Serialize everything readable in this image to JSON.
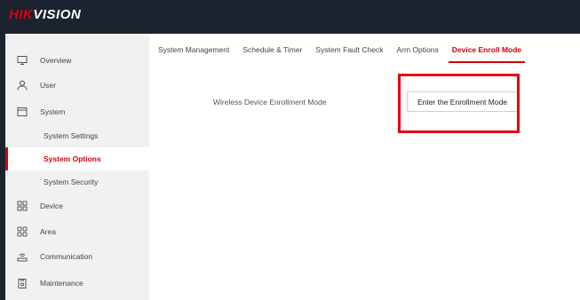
{
  "brand": {
    "logo_part1": "HIK",
    "logo_part2": "VISION",
    "accent_color": "#d7000f"
  },
  "sidebar": {
    "items": [
      {
        "label": "Overview",
        "icon": "monitor-icon"
      },
      {
        "label": "User",
        "icon": "user-icon"
      },
      {
        "label": "System",
        "icon": "window-icon"
      },
      {
        "label": "Device",
        "icon": "grid-icon"
      },
      {
        "label": "Area",
        "icon": "area-icon"
      },
      {
        "label": "Communication",
        "icon": "network-icon"
      },
      {
        "label": "Maintenance",
        "icon": "clipboard-icon"
      }
    ],
    "system_subitems": [
      {
        "label": "System Settings",
        "active": false
      },
      {
        "label": "System Options",
        "active": true
      },
      {
        "label": "System Security",
        "active": false
      }
    ]
  },
  "tabs": [
    {
      "label": "System Management",
      "active": false
    },
    {
      "label": "Schedule & Timer",
      "active": false
    },
    {
      "label": "System Fault Check",
      "active": false
    },
    {
      "label": "Arm Options",
      "active": false
    },
    {
      "label": "Device Enroll Mode",
      "active": true
    }
  ],
  "content": {
    "field_label": "Wireless Device Enrollment Mode",
    "button_label": "Enter the Enrollment Mode",
    "highlight_color": "#e60012"
  }
}
